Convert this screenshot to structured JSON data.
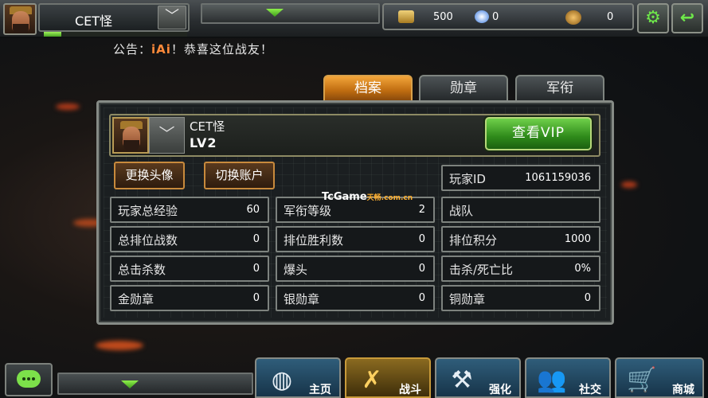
{
  "topbar": {
    "player_name": "CET怪",
    "dropdown_glyph": "﹀",
    "gold": "500",
    "diamond": "0",
    "medal_points": "0",
    "icons": [
      "gold-bars-icon",
      "diamond-icon",
      "medal-coin-icon",
      "gear-icon",
      "back-arrow-icon"
    ]
  },
  "notice": {
    "prefix": "公告：",
    "tag": "iAi",
    "message": "！恭喜这位战友！"
  },
  "tabs": [
    {
      "label": "档案",
      "active": true
    },
    {
      "label": "勋章",
      "active": false
    },
    {
      "label": "军衔",
      "active": false
    }
  ],
  "profile": {
    "name": "CET怪",
    "level": "LV2",
    "dropdown_glyph": "﹀",
    "vip_button": "查看VIP",
    "change_avatar": "更换头像",
    "switch_account": "切换账户"
  },
  "player_id": {
    "label": "玩家ID",
    "value": "1061159036"
  },
  "stats": {
    "row1": [
      {
        "label": "玩家总经验",
        "value": "60"
      },
      {
        "label": "军衔等级",
        "value": "2"
      },
      {
        "label": "战队",
        "value": ""
      }
    ],
    "row2": [
      {
        "label": "总排位战数",
        "value": "0"
      },
      {
        "label": "排位胜利数",
        "value": "0"
      },
      {
        "label": "排位积分",
        "value": "1000"
      }
    ],
    "row3": [
      {
        "label": "总击杀数",
        "value": "0"
      },
      {
        "label": "爆头",
        "value": "0"
      },
      {
        "label": "击杀/死亡比",
        "value": "0%"
      }
    ],
    "row4": [
      {
        "label": "金勋章",
        "value": "0"
      },
      {
        "label": "银勋章",
        "value": "0"
      },
      {
        "label": "铜勋章",
        "value": "0"
      }
    ]
  },
  "watermark": {
    "main": "TcGame",
    "sub": "天畅",
    "domain": ".com.cn"
  },
  "bottom_nav": [
    {
      "label": "主页",
      "icon": "globe-icon",
      "active": false
    },
    {
      "label": "战斗",
      "icon": "crossed-pistols-icon",
      "active": true
    },
    {
      "label": "强化",
      "icon": "wrench-icon",
      "active": false
    },
    {
      "label": "社交",
      "icon": "people-icon",
      "active": false
    },
    {
      "label": "商城",
      "icon": "cart-icon",
      "active": false
    }
  ],
  "colors": {
    "accent_orange": "#f3a53a",
    "vip_green": "#2e8a1a",
    "xp_green": "#7ce04a"
  },
  "xp_progress": 0.12
}
